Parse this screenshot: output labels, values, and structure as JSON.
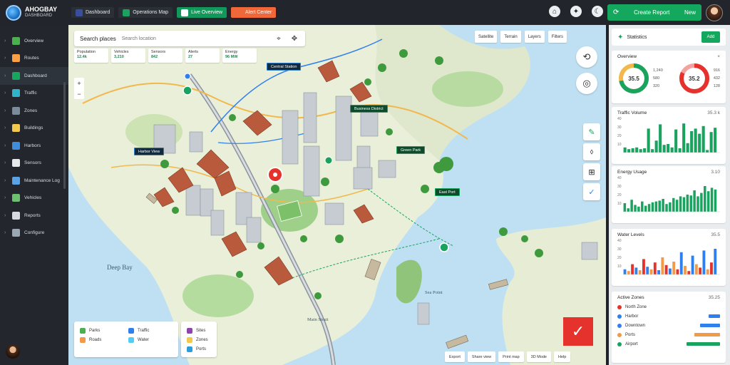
{
  "app": {
    "title": "AHOGBAY",
    "subtitle": "DASHBOARD"
  },
  "topnav": [
    {
      "label": "Dashboard",
      "icon": "grid-icon",
      "color": "#3a4ea0",
      "style": "dark"
    },
    {
      "label": "Operations Map",
      "icon": "map-icon",
      "color": "#1aa35f",
      "style": "dark"
    },
    {
      "label": "Live Overview",
      "icon": "layers-icon",
      "color": "#ffffff",
      "style": "green"
    },
    {
      "label": "Alert Center",
      "icon": "bell-icon",
      "color": "#f0683a",
      "style": "orange"
    }
  ],
  "top_icons": [
    "home-icon",
    "compass-icon",
    "moon-icon"
  ],
  "top_cta": {
    "label": "Create Report",
    "value": "New"
  },
  "sidebar": {
    "items": [
      {
        "label": "Overview",
        "icon": "leaf-icon",
        "color": "#4caf50"
      },
      {
        "label": "Routes",
        "icon": "route-icon",
        "color": "#ff9f43"
      },
      {
        "label": "Dashboard",
        "icon": "chart-icon",
        "color": "#14a85e",
        "active": true
      },
      {
        "label": "Traffic",
        "icon": "car-icon",
        "color": "#2fb4c9"
      },
      {
        "label": "Zones",
        "icon": "box-icon",
        "color": "#7a8b99"
      },
      {
        "label": "Buildings",
        "icon": "building-icon",
        "color": "#f2c94c"
      },
      {
        "label": "Harbors",
        "icon": "anchor-icon",
        "color": "#3f8ede"
      },
      {
        "label": "Sensors",
        "icon": "sensor-icon",
        "color": "#e6e9ec"
      },
      {
        "label": "Maintenance Log",
        "icon": "tree-icon",
        "color": "#5aa3e6"
      },
      {
        "label": "Vehicles",
        "icon": "truck-icon",
        "color": "#6cc070"
      },
      {
        "label": "Reports",
        "icon": "file-icon",
        "color": "#d7dbe0"
      },
      {
        "label": "Configure",
        "icon": "settings-icon",
        "color": "#9aa7b5"
      }
    ]
  },
  "map": {
    "search": {
      "label": "Search places",
      "placeholder": "Search location"
    },
    "chips": [
      {
        "title": "Population",
        "value": "12.4k"
      },
      {
        "title": "Vehicles",
        "value": "3,210"
      },
      {
        "title": "Sensors",
        "value": "842"
      },
      {
        "title": "Alerts",
        "value": "27"
      },
      {
        "title": "Energy",
        "value": "96 MW"
      }
    ],
    "buttons": [
      "Satellite",
      "Terrain",
      "Layers",
      "Filters"
    ],
    "tags": [
      {
        "label": "Central Station",
        "kind": "blue"
      },
      {
        "label": "Business District",
        "kind": "green"
      },
      {
        "label": "Harbor View",
        "kind": "blue"
      },
      {
        "label": "Green Park",
        "kind": "green"
      },
      {
        "label": "East Port",
        "kind": "green"
      }
    ],
    "labels": {
      "bay": "Deep Bay",
      "island": "Sea Point",
      "strait": "Main Strait"
    },
    "legend_left": [
      {
        "label": "Parks",
        "color": "#4caf50"
      },
      {
        "label": "Traffic",
        "color": "#2f80ed"
      },
      {
        "label": "Roads",
        "color": "#f2994a"
      },
      {
        "label": "Water",
        "color": "#56ccf2"
      }
    ],
    "legend_right": [
      {
        "label": "Sites",
        "color": "#8e44ad"
      },
      {
        "label": "Zones",
        "color": "#f2c94c"
      },
      {
        "label": "Ports",
        "color": "#2d9cdb"
      }
    ],
    "bottom_buttons": [
      "Export",
      "Share view",
      "Print map",
      "3D Mode",
      "Help"
    ]
  },
  "panel": {
    "title": "Statistics",
    "button": "Add",
    "overview": {
      "title": "Overview",
      "gauges": [
        {
          "value": "35.5",
          "percent": 0.72,
          "color": "#1aa35f",
          "color2": "#f2b84b",
          "stats": [
            "1,240",
            "580",
            "320"
          ]
        },
        {
          "value": "35.2",
          "percent": 0.82,
          "color": "#e5322d",
          "color2": "#f2a3a0",
          "stats": [
            "916",
            "432",
            "128"
          ]
        }
      ]
    },
    "charts": [
      {
        "title": "Traffic Volume",
        "value": "35.3 k",
        "ticks": [
          "40",
          "30",
          "20",
          "10"
        ],
        "colors": [
          "#1aa35f"
        ],
        "values": [
          6,
          4,
          5,
          6,
          4,
          5,
          28,
          4,
          14,
          33,
          9,
          10,
          6,
          27,
          5,
          34,
          11,
          25,
          28,
          22,
          31,
          3,
          24,
          29
        ]
      },
      {
        "title": "Energy Usage",
        "value": "3.10",
        "ticks": [
          "40",
          "30",
          "20",
          "10"
        ],
        "colors": [
          "#1aa35f"
        ],
        "values": [
          10,
          4,
          14,
          8,
          6,
          12,
          7,
          9,
          11,
          12,
          13,
          15,
          9,
          11,
          16,
          14,
          18,
          17,
          20,
          19,
          25,
          18,
          22,
          30,
          24,
          28,
          26
        ]
      },
      {
        "title": "Water Levels",
        "value": "35.5",
        "ticks": [
          "40",
          "30",
          "20",
          "10"
        ],
        "colors": [
          "#2f80ed",
          "#f2994a",
          "#e5322d"
        ],
        "values": [
          6,
          4,
          12,
          8,
          5,
          18,
          9,
          6,
          14,
          5,
          20,
          11,
          7,
          15,
          6,
          26,
          10,
          4,
          22,
          12,
          8,
          28,
          6,
          14,
          30
        ]
      }
    ],
    "list": {
      "title": "Active Zones",
      "value": "35.25",
      "items": [
        {
          "label": "North Zone",
          "color": "#e5322d",
          "fraction": 0
        },
        {
          "label": "Harbor",
          "color": "#2f80ed",
          "fraction": 0.31
        },
        {
          "label": "Downtown",
          "color": "#2f80ed",
          "fraction": 0.53
        },
        {
          "label": "Ports",
          "color": "#f2994a",
          "fraction": 0.69
        },
        {
          "label": "Airport",
          "color": "#1aa35f",
          "fraction": 0.9
        }
      ]
    }
  }
}
